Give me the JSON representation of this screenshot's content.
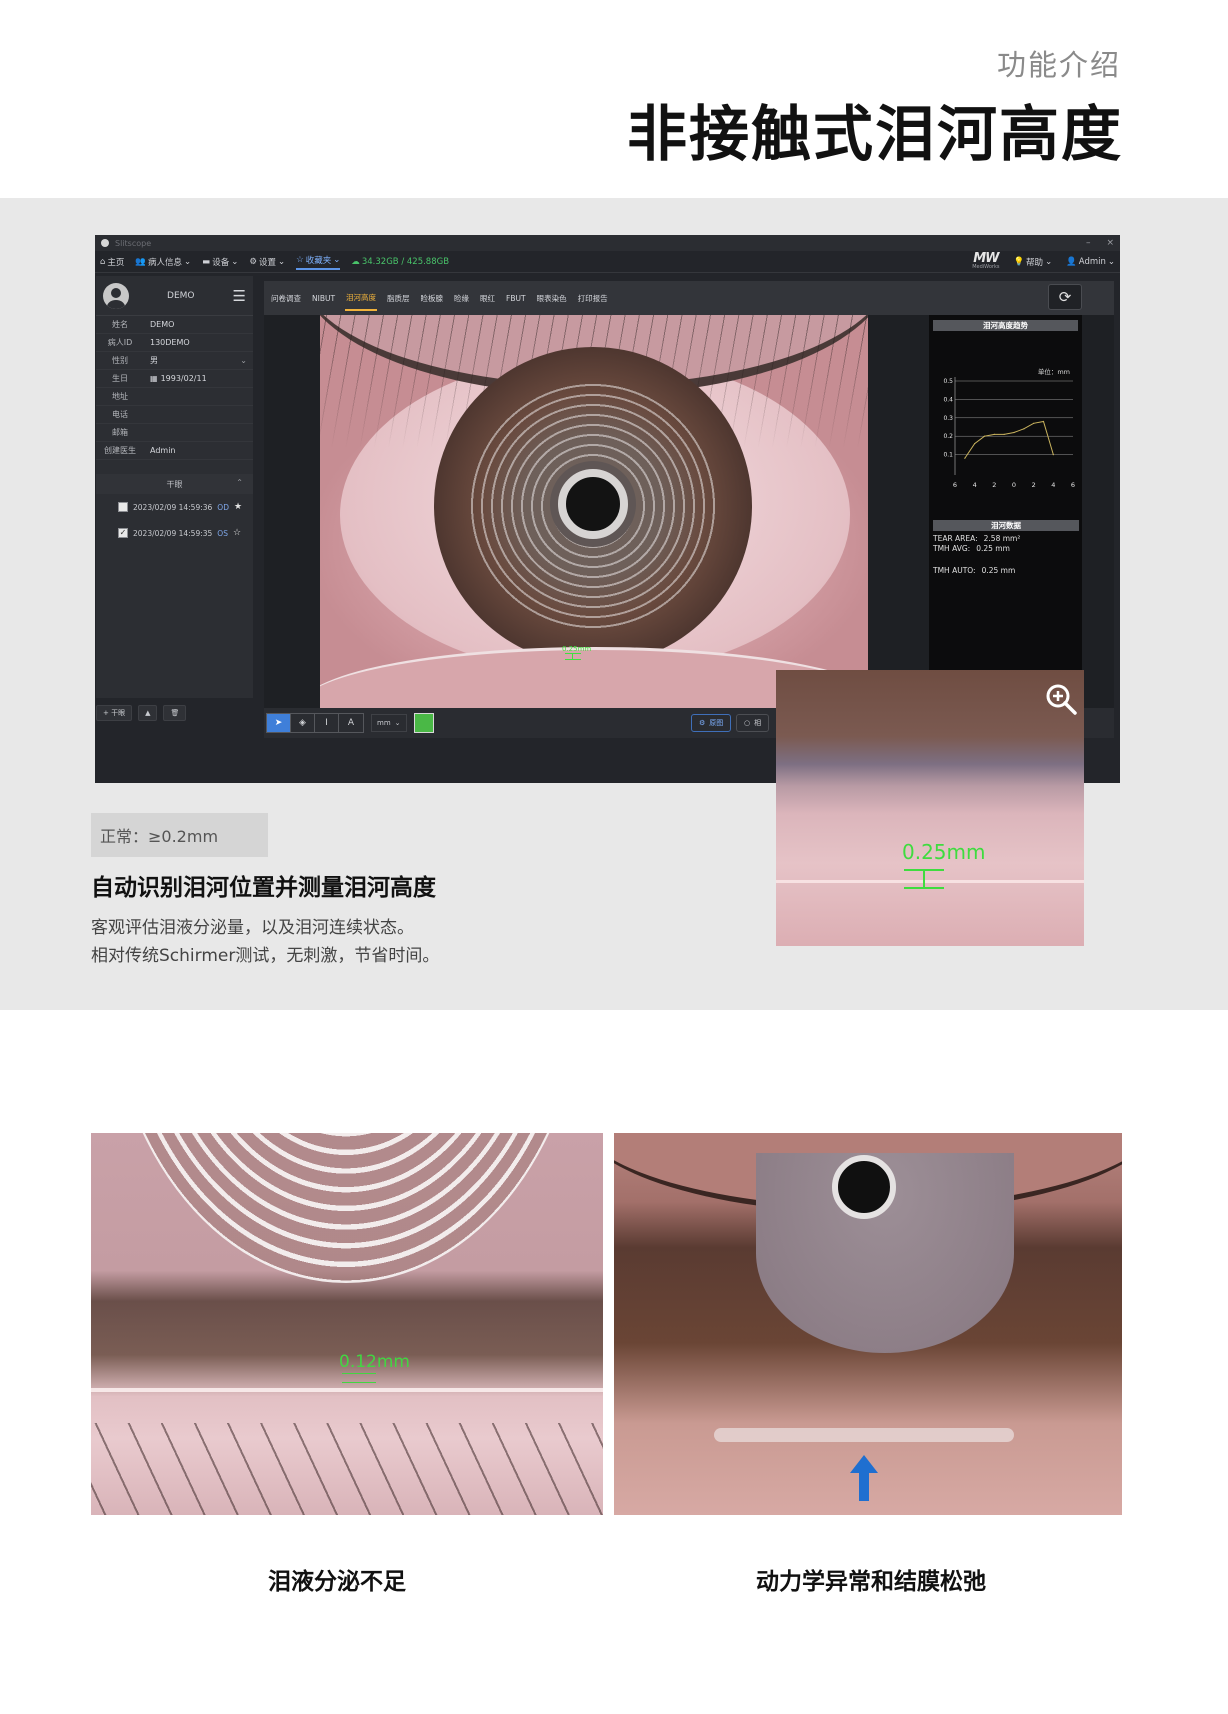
{
  "page": {
    "kicker": "功能介绍",
    "headline": "非接触式泪河高度"
  },
  "app": {
    "title": "Slitscope",
    "window_controls": [
      "–",
      "×"
    ],
    "menu": [
      {
        "label": "主页",
        "icon": "home-icon"
      },
      {
        "label": "病人信息",
        "icon": "users-icon"
      },
      {
        "label": "设备",
        "icon": "device-icon"
      },
      {
        "label": "设置",
        "icon": "gear-icon"
      },
      {
        "label": "收藏夹",
        "icon": "star-icon",
        "active": true
      }
    ],
    "storage": "34.32GB / 425.88GB",
    "brand_name": "MediWorks",
    "help": "帮助",
    "user": "Admin"
  },
  "sidebar": {
    "patient_name": "DEMO",
    "fields": [
      {
        "label": "姓名",
        "value": "DEMO"
      },
      {
        "label": "病人ID",
        "value": "130DEMO"
      },
      {
        "label": "性别",
        "value": "男"
      },
      {
        "label": "生日",
        "value": "1993/02/11"
      },
      {
        "label": "地址",
        "value": ""
      },
      {
        "label": "电话",
        "value": ""
      },
      {
        "label": "邮箱",
        "value": ""
      },
      {
        "label": "创建医生",
        "value": "Admin"
      }
    ],
    "group_label": "干眼",
    "sessions": [
      {
        "datetime": "2023/02/09 14:59:36",
        "eye": "OD",
        "checked": false
      },
      {
        "datetime": "2023/02/09 14:59:35",
        "eye": "OS",
        "checked": true
      }
    ],
    "buttons": [
      "+ 干眼",
      "▲",
      "🗑"
    ]
  },
  "tabs": [
    "问卷调查",
    "NIBUT",
    "泪河高度",
    "脂质层",
    "睑板腺",
    "睑缘",
    "眼红",
    "FBUT",
    "眼表染色",
    "打印报告"
  ],
  "active_tab": "泪河高度",
  "viewer": {
    "measurement": "0.25mm"
  },
  "panel": {
    "trend_title": "泪河高度趋势",
    "unit_label": "单位：mm",
    "data_title": "泪河数据",
    "tear_area_label": "TEAR AREA:",
    "tear_area_value": "2.58 mm²",
    "tmh_avg_label": "TMH AVG:",
    "tmh_avg_value": "0.25 mm",
    "tmh_auto_label": "TMH AUTO:",
    "tmh_auto_value": "0.25 mm"
  },
  "chart_data": {
    "type": "line",
    "title": "泪河高度趋势",
    "xlabel": "",
    "ylabel": "",
    "x_ticks": [
      "6",
      "4",
      "2",
      "0",
      "2",
      "4",
      "6"
    ],
    "y_ticks": [
      "0.5",
      "0.4",
      "0.3",
      "0.2",
      "0.1"
    ],
    "ylim": [
      0,
      0.5
    ],
    "series": [
      {
        "x": [
          -5,
          -4,
          -3,
          -2,
          -1,
          0,
          1,
          2,
          3,
          4
        ],
        "values": [
          0.08,
          0.16,
          0.2,
          0.21,
          0.21,
          0.22,
          0.24,
          0.27,
          0.28,
          0.1
        ]
      }
    ],
    "grid": true
  },
  "toolbar": {
    "unit": "mm",
    "tools": [
      "pointer",
      "eraser",
      "text-cursor",
      "A"
    ],
    "color": "#4ab846",
    "pill1": "原图",
    "pill2": "相"
  },
  "inset": {
    "measurement": "0.25mm"
  },
  "feature": {
    "normal_range": "正常：≥0.2mm",
    "heading": "自动识别泪河位置并测量泪河高度",
    "desc_line1": "客观评估泪液分泌量，以及泪河连续状态。",
    "desc_line2": "相对传统Schirmer测试，无刺激，节省时间。"
  },
  "examples": {
    "left_measurement": "0.12mm",
    "left_caption": "泪液分泌不足",
    "right_caption": "动力学异常和结膜松弛",
    "arrow_color": "#1f6fd0"
  }
}
